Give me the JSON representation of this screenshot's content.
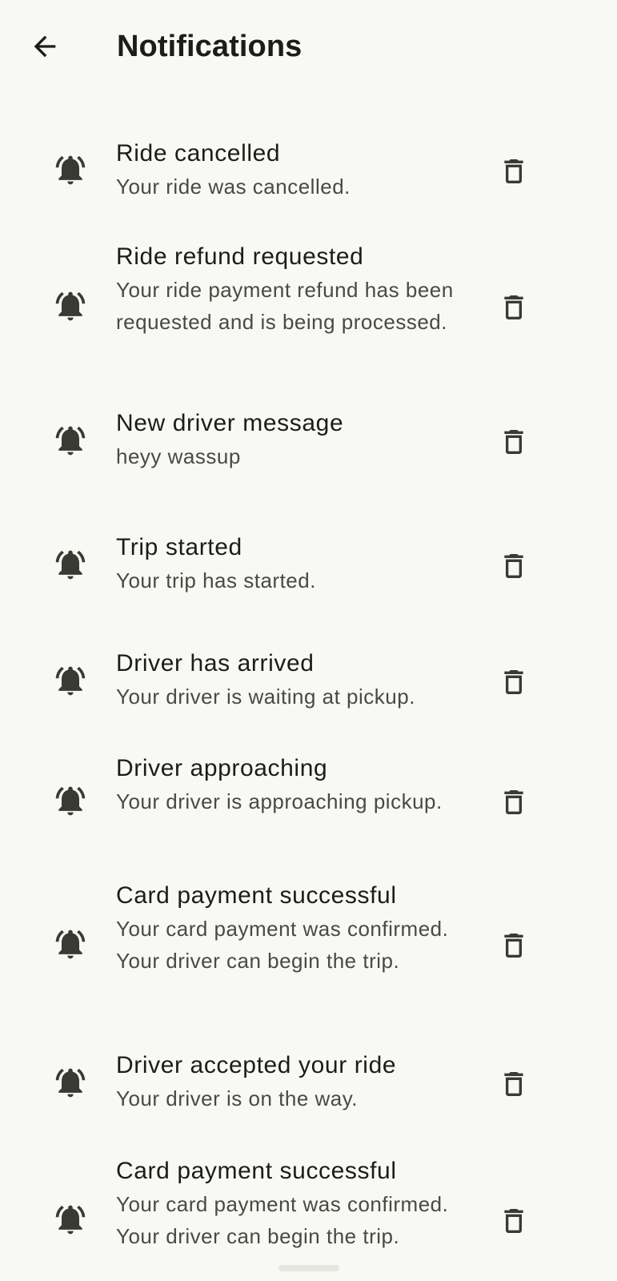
{
  "app_bar": {
    "title": "Notifications",
    "back_icon": "arrow-back-icon"
  },
  "notifications": [
    {
      "title": "Ride cancelled",
      "body": "Your ride was cancelled.",
      "icon": "bell-ringing-icon",
      "action_icon": "trash-icon"
    },
    {
      "title": "Ride refund requested",
      "body": "Your ride payment refund has been requested and is being processed.",
      "icon": "bell-ringing-icon",
      "action_icon": "trash-icon"
    },
    {
      "title": "New driver message",
      "body": "heyy wassup",
      "icon": "bell-ringing-icon",
      "action_icon": "trash-icon"
    },
    {
      "title": "Trip started",
      "body": "Your trip has started.",
      "icon": "bell-ringing-icon",
      "action_icon": "trash-icon"
    },
    {
      "title": "Driver has arrived",
      "body": "Your driver is waiting at pickup.",
      "icon": "bell-ringing-icon",
      "action_icon": "trash-icon"
    },
    {
      "title": "Driver approaching",
      "body": "Your driver is approaching pickup.",
      "icon": "bell-ringing-icon",
      "action_icon": "trash-icon"
    },
    {
      "title": "Card payment successful",
      "body": "Your card payment was confirmed. Your driver can begin the trip.",
      "icon": "bell-ringing-icon",
      "action_icon": "trash-icon"
    },
    {
      "title": "Driver accepted your ride",
      "body": "Your driver is on the way.",
      "icon": "bell-ringing-icon",
      "action_icon": "trash-icon"
    },
    {
      "title": "Card payment successful",
      "body": "Your card payment was confirmed. Your driver can begin the trip.",
      "icon": "bell-ringing-icon",
      "action_icon": "trash-icon"
    }
  ],
  "colors": {
    "background": "#f8f8f4",
    "text_primary": "#1c1c18",
    "text_secondary": "#4a4a44",
    "icon": "#3a3a34"
  }
}
